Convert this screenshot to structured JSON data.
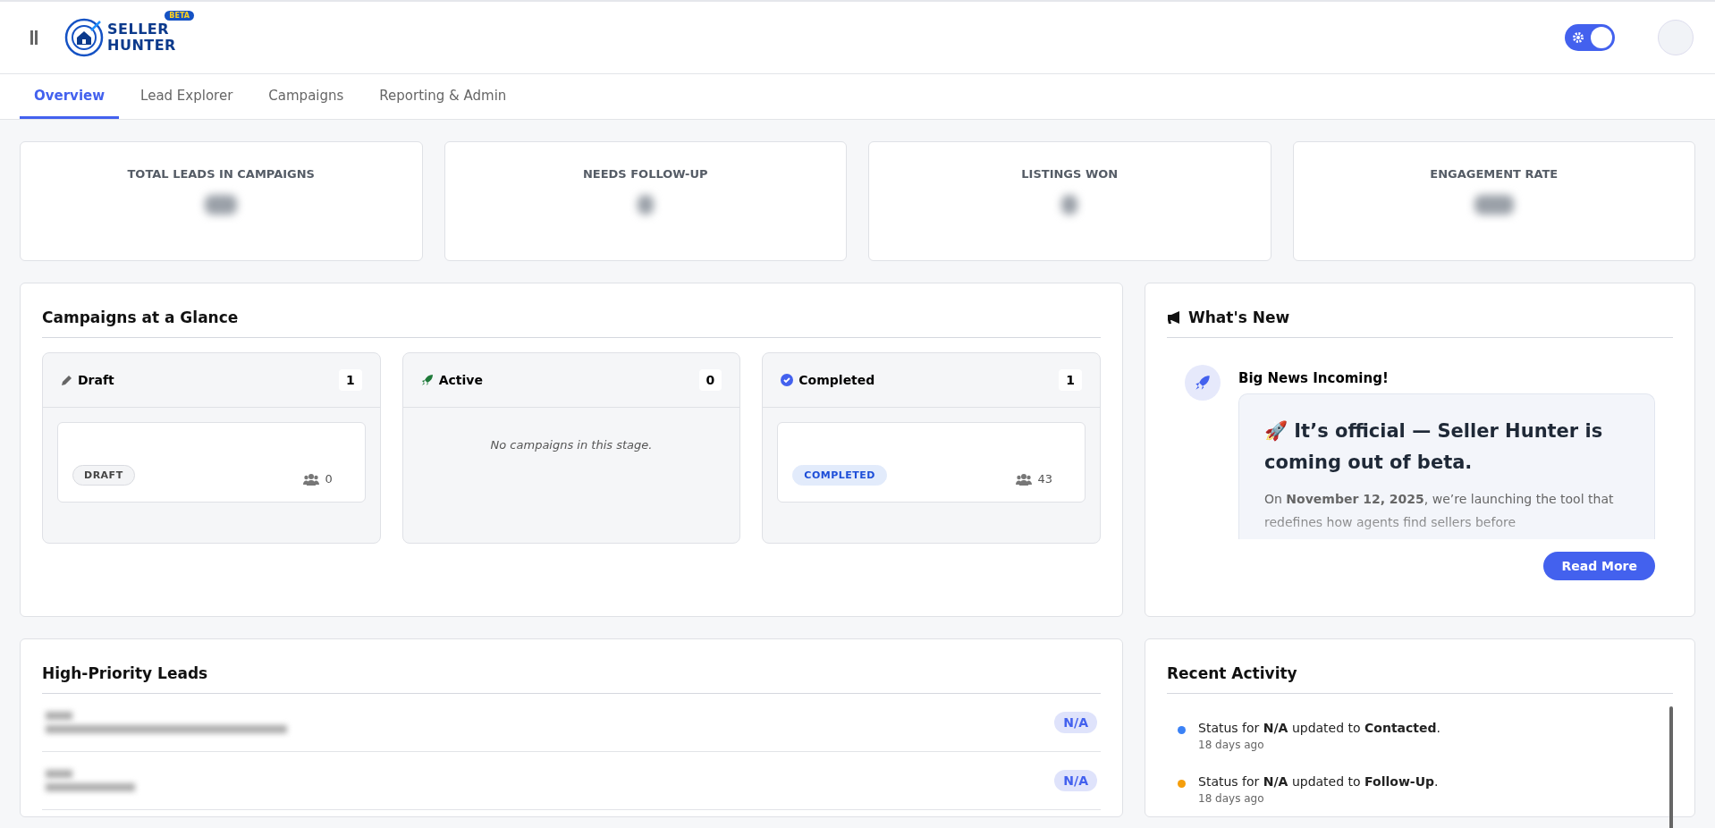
{
  "header": {
    "logo": {
      "line1": "SELLER",
      "line2": "HUNTER",
      "badge": "BETA"
    },
    "theme_toggle": {
      "on": true
    }
  },
  "tabs": [
    {
      "label": "Overview",
      "selected": true
    },
    {
      "label": "Lead Explorer",
      "selected": false
    },
    {
      "label": "Campaigns",
      "selected": false
    },
    {
      "label": "Reporting & Admin",
      "selected": false
    }
  ],
  "stats": [
    {
      "label": "TOTAL LEADS IN CAMPAIGNS"
    },
    {
      "label": "NEEDS FOLLOW-UP"
    },
    {
      "label": "LISTINGS WON"
    },
    {
      "label": "ENGAGEMENT RATE"
    }
  ],
  "campaigns": {
    "title": "Campaigns at a Glance",
    "columns": [
      {
        "kind": "draft",
        "title": "Draft",
        "count": "1",
        "items": [
          {
            "status": "DRAFT",
            "kind": "draft",
            "contacts": "0"
          }
        ]
      },
      {
        "kind": "active",
        "title": "Active",
        "count": "0",
        "empty": "No campaigns in this stage."
      },
      {
        "kind": "completed",
        "title": "Completed",
        "count": "1",
        "items": [
          {
            "status": "COMPLETED",
            "kind": "completed",
            "contacts": "43"
          }
        ]
      }
    ]
  },
  "whats_new": {
    "title": "What's New",
    "item_title": "Big News Incoming!",
    "headline": "🚀 It’s official — Seller Hunter is coming out of beta.",
    "body": "On **November 12, 2025**, we’re launching the tool that redefines how agents find sellers before",
    "button": "Read More"
  },
  "leads": {
    "title": "High-Priority Leads",
    "rows": [
      {
        "badge": "N/A"
      },
      {
        "badge": "N/A"
      }
    ]
  },
  "activity": {
    "title": "Recent Activity",
    "items": [
      {
        "text": "Status for **N/A** updated to **Contacted**.",
        "time": "18 days ago",
        "color": "#3b82f6"
      },
      {
        "text": "Status for **N/A** updated to **Follow-Up**.",
        "time": "18 days ago",
        "color": "#f59e0b"
      }
    ]
  }
}
